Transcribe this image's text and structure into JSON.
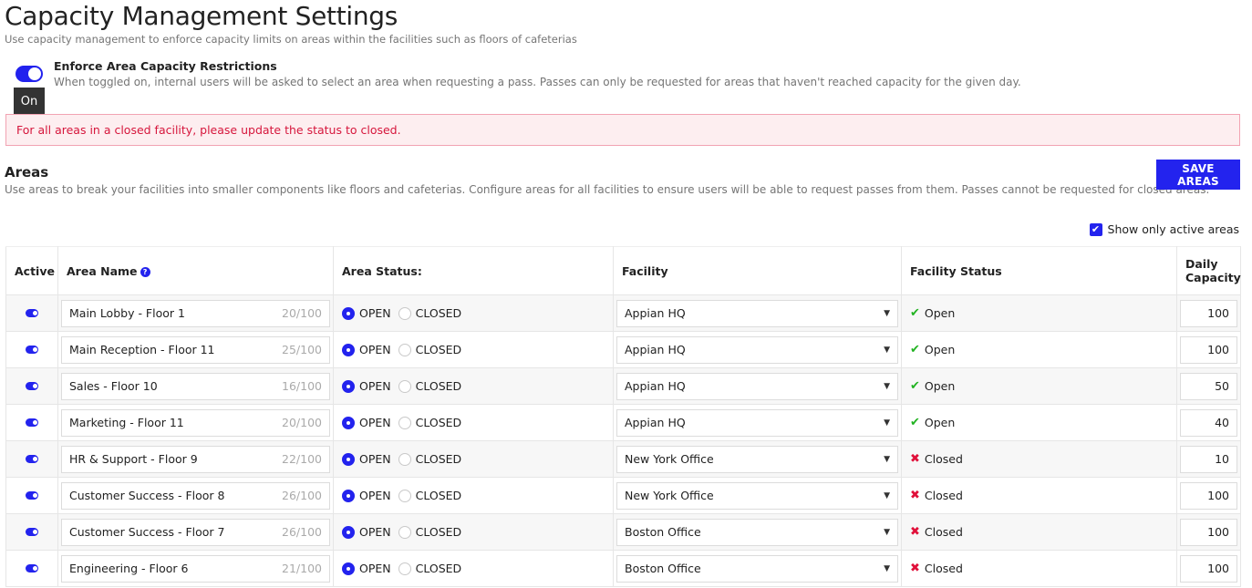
{
  "header": {
    "title": "Capacity Management Settings",
    "subtitle": "Use capacity management to enforce capacity limits on areas within the facilities such as floors of cafeterias"
  },
  "enforce": {
    "label": "Enforce Area Capacity Restrictions",
    "description": "When toggled on, internal users will be asked to select an area when requesting a pass. Passes can only be requested for areas that haven't reached capacity for the given day.",
    "enabled": true,
    "tooltip": "On"
  },
  "alert": {
    "message": "For all areas in a closed facility, please update the status to closed."
  },
  "areas": {
    "title": "Areas",
    "description": "Use areas to break your facilities into smaller components like floors and cafeterias. Configure areas for all facilities to ensure users will be able to request passes from them. Passes cannot be requested for closed areas.",
    "save_label": "SAVE AREAS",
    "show_active_label": "Show only active areas",
    "show_active_checked": true,
    "columns": {
      "active": "Active",
      "name": "Area Name",
      "status": "Area Status:",
      "facility": "Facility",
      "facility_status": "Facility Status",
      "capacity": "Daily Capacity"
    },
    "radio_open": "OPEN",
    "radio_closed": "CLOSED",
    "rows": [
      {
        "active": true,
        "name": "Main Lobby - Floor 1",
        "count": "20/100",
        "status": "OPEN",
        "facility": "Appian HQ",
        "facility_status": "Open",
        "capacity": "100"
      },
      {
        "active": true,
        "name": "Main Reception - Floor 11",
        "count": "25/100",
        "status": "OPEN",
        "facility": "Appian HQ",
        "facility_status": "Open",
        "capacity": "100"
      },
      {
        "active": true,
        "name": "Sales - Floor 10",
        "count": "16/100",
        "status": "OPEN",
        "facility": "Appian HQ",
        "facility_status": "Open",
        "capacity": "50"
      },
      {
        "active": true,
        "name": "Marketing - Floor 11",
        "count": "20/100",
        "status": "OPEN",
        "facility": "Appian HQ",
        "facility_status": "Open",
        "capacity": "40"
      },
      {
        "active": true,
        "name": "HR & Support - Floor 9",
        "count": "22/100",
        "status": "OPEN",
        "facility": "New York Office",
        "facility_status": "Closed",
        "capacity": "10"
      },
      {
        "active": true,
        "name": "Customer Success - Floor 8",
        "count": "26/100",
        "status": "OPEN",
        "facility": "New York Office",
        "facility_status": "Closed",
        "capacity": "100"
      },
      {
        "active": true,
        "name": "Customer Success - Floor 7",
        "count": "26/100",
        "status": "OPEN",
        "facility": "Boston Office",
        "facility_status": "Closed",
        "capacity": "100"
      },
      {
        "active": true,
        "name": "Engineering - Floor 6",
        "count": "21/100",
        "status": "OPEN",
        "facility": "Boston Office",
        "facility_status": "Closed",
        "capacity": "100"
      }
    ]
  },
  "colors": {
    "accent": "#2323ee",
    "alert_text": "#d6163c",
    "alert_bg": "#fdeef0",
    "ok": "#22b322",
    "error": "#e0103a"
  }
}
